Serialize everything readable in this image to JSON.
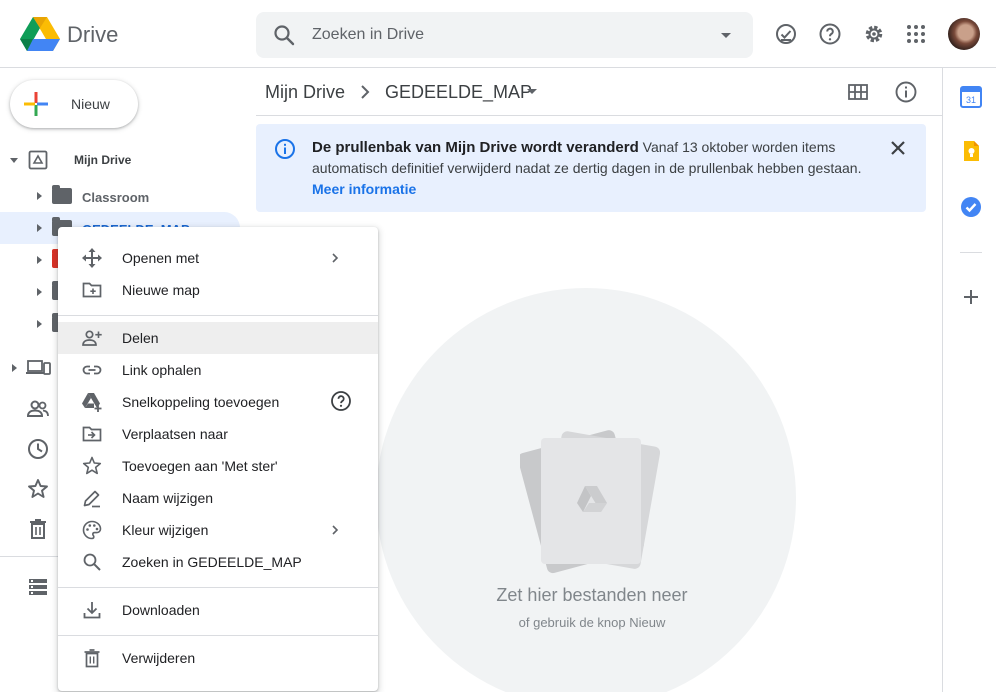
{
  "header": {
    "brand": "Drive",
    "search_placeholder": "Zoeken in Drive"
  },
  "sidebar": {
    "new_label": "Nieuw",
    "tree_root": "Mijn Drive",
    "folders": [
      {
        "label": "Classroom",
        "color": "#5f6368"
      },
      {
        "label": "GEDEELDE_MAP",
        "color": "#5f6368"
      },
      {
        "label": "",
        "color": "#d93025"
      },
      {
        "label": "",
        "color": "#5f6368"
      },
      {
        "label": "",
        "color": "#5f6368"
      }
    ]
  },
  "breadcrumb": {
    "root": "Mijn Drive",
    "current": "GEDEELDE_MAP"
  },
  "banner": {
    "title": "De prullenbak van Mijn Drive wordt veranderd",
    "body": " Vanaf 13 oktober worden items automatisch definitief verwijderd nadat ze dertig dagen in de prullenbak hebben gestaan. ",
    "link": "Meer informatie"
  },
  "empty_state": {
    "title": "Zet hier bestanden neer",
    "subtitle": "of gebruik de knop Nieuw"
  },
  "context_menu": {
    "items": [
      {
        "label": "Openen met",
        "icon": "move-icon",
        "submenu": true
      },
      {
        "label": "Nieuwe map",
        "icon": "new-folder-icon"
      },
      {
        "label": "Delen",
        "icon": "add-person-icon"
      },
      {
        "label": "Link ophalen",
        "icon": "link-icon"
      },
      {
        "label": "Snelkoppeling toevoegen",
        "icon": "shortcut-icon",
        "help": true
      },
      {
        "label": "Verplaatsen naar",
        "icon": "move-to-icon"
      },
      {
        "label": "Toevoegen aan 'Met ster'",
        "icon": "star-icon"
      },
      {
        "label": "Naam wijzigen",
        "icon": "pencil-icon"
      },
      {
        "label": "Kleur wijzigen",
        "icon": "palette-icon",
        "submenu": true
      },
      {
        "label": "Zoeken in GEDEELDE_MAP",
        "icon": "search-icon"
      },
      {
        "label": "Downloaden",
        "icon": "download-icon"
      },
      {
        "label": "Verwijderen",
        "icon": "trash-icon"
      }
    ]
  },
  "rail": {
    "calendar_day": "31"
  },
  "colors": {
    "accent": "#1a73e8",
    "banner_bg": "#e8f0fe",
    "selected_bg": "#e8f0fe"
  }
}
